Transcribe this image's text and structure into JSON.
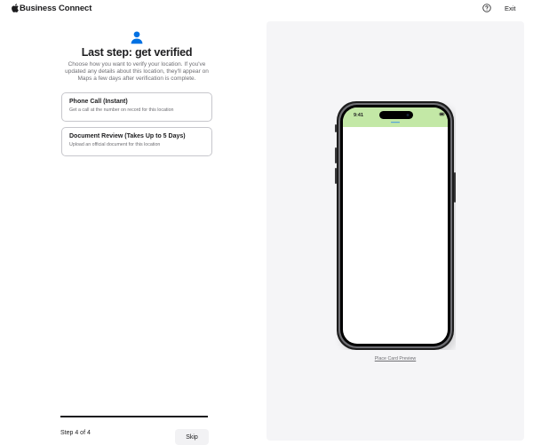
{
  "header": {
    "brand_name": "Business Connect",
    "exit_label": "Exit"
  },
  "main": {
    "title": "Last step: get verified",
    "description": "Choose how you want to verify your location. If you've updated any details about this location, they'll appear on Maps a few days after verification is complete.",
    "options": [
      {
        "title": "Phone Call (Instant)",
        "subtitle": "Get a call at the number on record for this location"
      },
      {
        "title": "Document Review (Takes Up to 5 Days)",
        "subtitle": "Upload an official document for this location"
      }
    ]
  },
  "footer": {
    "step_label": "Step 4 of 4",
    "progress": 1.0,
    "skip_label": "Skip"
  },
  "preview": {
    "status_time": "9:41",
    "link_label": "Place Card Preview"
  },
  "colors": {
    "accent": "#0071e3",
    "phone_header": "#c3e8a6",
    "text_primary": "#1d1d1f",
    "text_secondary": "#6e6e73",
    "panel_background": "#f5f5f7"
  },
  "icons": {
    "brand": "apple-logo-icon",
    "help": "question-circle-icon",
    "user": "person-icon"
  }
}
